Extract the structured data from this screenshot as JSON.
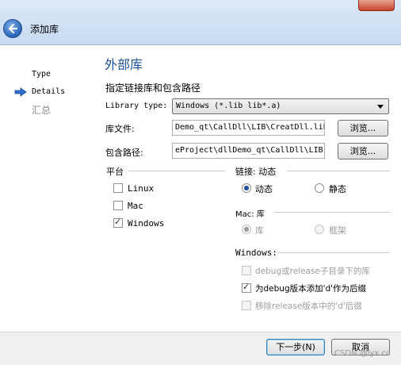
{
  "window": {
    "title": "添加库"
  },
  "steps": [
    {
      "label": "Type"
    },
    {
      "label": "Details"
    },
    {
      "label": "汇总"
    }
  ],
  "page": {
    "heading": "外部库",
    "subheading": "指定链接库和包含路径"
  },
  "library_type": {
    "label": "Library type:",
    "value": "Windows (*.lib lib*.a)"
  },
  "library_file": {
    "label": "库文件:",
    "value": "Demo_qt\\CallDll\\LIB\\CreatDll.lib",
    "browse": "浏览..."
  },
  "include_path": {
    "label": "包含路径:",
    "value": "eProject\\dllDemo_qt\\CallDll\\LIB",
    "browse": "浏览..."
  },
  "platform": {
    "title": "平台",
    "options": [
      {
        "label": "Linux",
        "checked": false
      },
      {
        "label": "Mac",
        "checked": false
      },
      {
        "label": "Windows",
        "checked": true
      }
    ]
  },
  "linking": {
    "title": "链接: 动态",
    "options": [
      {
        "label": "动态",
        "selected": true
      },
      {
        "label": "静态",
        "selected": false
      }
    ]
  },
  "mac": {
    "title": "Mac: 库",
    "options": [
      {
        "label": "库",
        "selected": true,
        "disabled": true
      },
      {
        "label": "框架",
        "selected": false,
        "disabled": true
      }
    ]
  },
  "windows": {
    "title": "Windows:",
    "options": [
      {
        "label": "debug或release子目录下的库",
        "checked": false,
        "disabled": true
      },
      {
        "label": "为debug版本添加'd'作为后缀",
        "checked": true,
        "disabled": false
      },
      {
        "label": "移除release版本中的'd'后缀",
        "checked": false,
        "disabled": true
      }
    ]
  },
  "footer": {
    "next": "下一步(N)",
    "cancel": "取消"
  },
  "watermark": "CSDN @lyx.cc"
}
